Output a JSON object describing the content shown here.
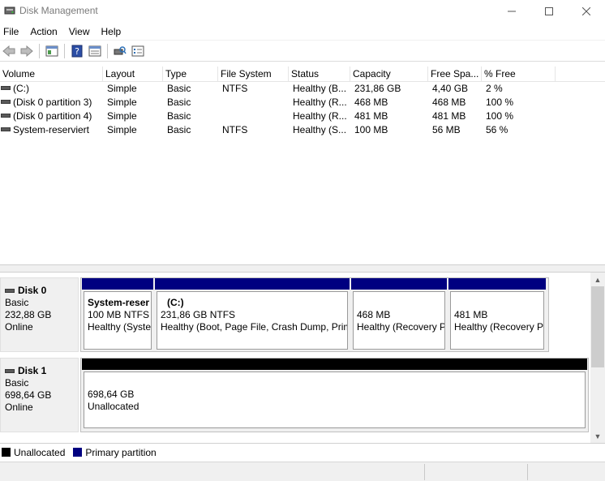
{
  "window": {
    "title": "Disk Management"
  },
  "menu": [
    "File",
    "Action",
    "View",
    "Help"
  ],
  "toolbar": [
    "back-icon",
    "forward-icon",
    "console-tree-icon",
    "help-icon",
    "properties-icon",
    "rescan-icon",
    "settings-icon"
  ],
  "volume_list": {
    "columns": [
      "Volume",
      "Layout",
      "Type",
      "File System",
      "Status",
      "Capacity",
      "Free Spa...",
      "% Free"
    ],
    "rows": [
      [
        "(C:)",
        "Simple",
        "Basic",
        "NTFS",
        "Healthy (B...",
        "231,86 GB",
        "4,40 GB",
        "2 %"
      ],
      [
        "(Disk 0 partition 3)",
        "Simple",
        "Basic",
        "",
        "Healthy (R...",
        "468 MB",
        "468 MB",
        "100 %"
      ],
      [
        "(Disk 0 partition 4)",
        "Simple",
        "Basic",
        "",
        "Healthy (R...",
        "481 MB",
        "481 MB",
        "100 %"
      ],
      [
        "System-reserviert",
        "Simple",
        "Basic",
        "NTFS",
        "Healthy (S...",
        "100 MB",
        "56 MB",
        "56 %"
      ]
    ]
  },
  "disks": [
    {
      "name": "Disk 0",
      "type": "Basic",
      "size": "232,88 GB",
      "state": "Online",
      "partitions": [
        {
          "title": "System-reser",
          "line1": "100 MB NTFS",
          "line2": "Healthy (Syste"
        },
        {
          "title": "(C:)",
          "line1": "231,86 GB NTFS",
          "line2": "Healthy (Boot, Page File, Crash Dump, Prim"
        },
        {
          "title": "",
          "line1": "468 MB",
          "line2": "Healthy (Recovery P"
        },
        {
          "title": "",
          "line1": "481 MB",
          "line2": "Healthy (Recovery P"
        }
      ]
    },
    {
      "name": "Disk 1",
      "type": "Basic",
      "size": "698,64 GB",
      "state": "Online",
      "partitions": [
        {
          "title": "",
          "line1": "698,64 GB",
          "line2": "Unallocated"
        }
      ]
    }
  ],
  "legend": [
    {
      "label": "Unallocated",
      "color": "#000000"
    },
    {
      "label": "Primary partition",
      "color": "#000080"
    }
  ],
  "colors": {
    "primary": "#000080",
    "unallocated": "#000000"
  }
}
